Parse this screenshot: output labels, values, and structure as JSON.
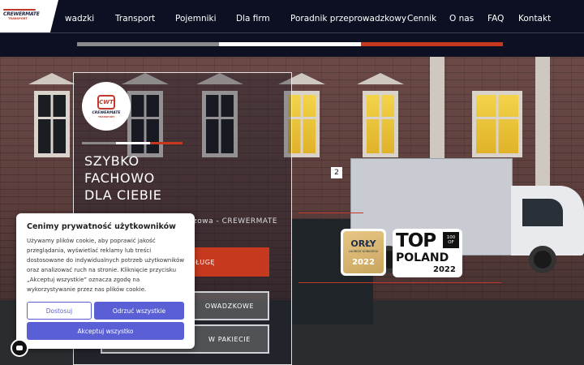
{
  "brand": {
    "logo_text": "CREWERMATE",
    "logo_sub": "TRANSPORT",
    "badge_icon_text": "CWT",
    "badge_text": "CREWERMATE",
    "badge_sub": "TRANSPORT"
  },
  "nav": {
    "items": [
      {
        "label": "wadzki"
      },
      {
        "label": "Transport"
      },
      {
        "label": "Pojemniki"
      },
      {
        "label": "Dla firm"
      },
      {
        "label": "Poradnik przeprowadzkowy"
      },
      {
        "label": "Cennik"
      },
      {
        "label": "O nas"
      },
      {
        "label": "FAQ"
      },
      {
        "label": "Kontakt"
      }
    ]
  },
  "hero": {
    "headline": [
      "SZYBKO",
      "FACHOWO",
      "DLA CIEBIE"
    ],
    "subtitle": "zowa - CREWERMATE",
    "cta_primary": "ZAMÓW USŁUGĘ",
    "cta_secondary_1": "OWADZKOWE",
    "cta_secondary_2": "W PAKIECIE",
    "address_number": "2"
  },
  "awards": {
    "orly_title": "ORŁY",
    "orly_sub": "LAUREAT KONKURSU",
    "orly_year": "2022",
    "top_title": "TOP",
    "top_badge_line1": "100",
    "top_badge_line2": "OF",
    "top_poland": "POLAND",
    "top_year": "2022"
  },
  "cookie": {
    "title": "Cenimy prywatność użytkowników",
    "body": "Używamy plików cookie, aby poprawić jakość przeglądania, wyświetlać reklamy lub treści dostosowane do indywidualnych potrzeb użytkowników oraz analizować ruch na stronie. Kliknięcie przycisku „Akceptuj wszystkie” oznacza zgodę na wykorzystywanie przez nas plików cookie.",
    "btn_customize": "Dostosuj",
    "btn_reject": "Odrzuć wszystkie",
    "btn_accept": "Akceptuj wszystko"
  },
  "colors": {
    "header_bg": "#0c1022",
    "accent_red": "#c6391f",
    "accent_violet": "#5a5fd6",
    "stripe_gray": "#8a8a8a",
    "stripe_white": "#ffffff"
  }
}
